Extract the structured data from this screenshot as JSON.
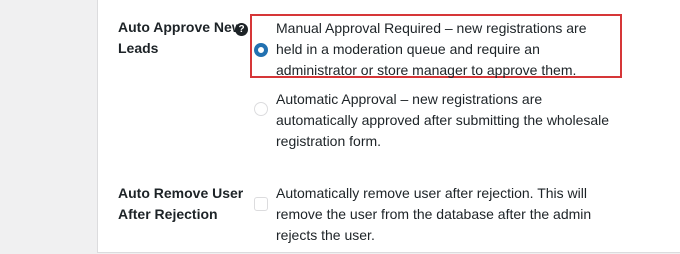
{
  "settings": {
    "auto_approve": {
      "label": "Auto Approve New Leads",
      "help_icon": "?",
      "options": [
        {
          "text": "Manual Approval Required – new registrations are held in a moderation queue and require an administrator or store manager to approve them.",
          "selected": true
        },
        {
          "text": "Automatic Approval – new registrations are automatically approved after submitting the wholesale registration form.",
          "selected": false
        }
      ]
    },
    "auto_remove": {
      "label": "Auto Remove User After Rejection",
      "checkbox_label": "Automatically remove user after rejection. This will remove the user from the database after the admin rejects the user.",
      "checked": false
    }
  },
  "colors": {
    "accent": "#2271b1",
    "highlight": "#d63638"
  }
}
